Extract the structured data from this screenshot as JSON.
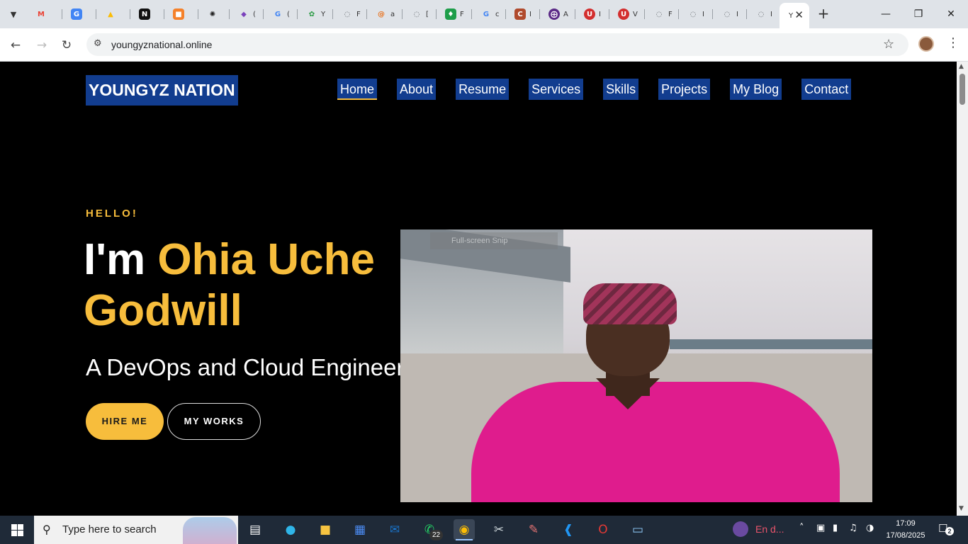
{
  "browser": {
    "tabs": [
      {
        "icon": "chevron-down-icon"
      },
      {
        "icon": "gmail-icon",
        "color": "#ea4335"
      },
      {
        "icon": "google-translate-icon",
        "color": "#4285f4"
      },
      {
        "icon": "google-drive-icon",
        "color": "#fbbc04"
      },
      {
        "icon": "notion-icon",
        "color": "#111111"
      },
      {
        "icon": "box-icon",
        "color": "#f5812a"
      },
      {
        "icon": "openai-icon",
        "color": "#222222"
      },
      {
        "icon": "terraform-icon",
        "color": "#7b42bc"
      },
      {
        "icon": "google-icon",
        "color": "#4285f4",
        "trunc": "("
      },
      {
        "icon": "leaf-icon",
        "color": "#2c9b45",
        "trunc": "Y"
      },
      {
        "icon": "globe-icon",
        "color": "#5f6368",
        "trunc": "F"
      },
      {
        "icon": "spiral-icon",
        "color": "#e8711c",
        "trunc": "a"
      },
      {
        "icon": "globe-icon",
        "color": "#5f6368",
        "trunc": "["
      },
      {
        "icon": "gem-icon",
        "color": "#1e9e4a",
        "trunc": "F"
      },
      {
        "icon": "google-icon",
        "color": "#4285f4",
        "trunc": "c"
      },
      {
        "icon": "letter-c-icon",
        "color": "#b04a2d",
        "trunc": "I"
      },
      {
        "icon": "target-icon",
        "color": "#5b2a86",
        "trunc": "A"
      },
      {
        "icon": "shield-icon",
        "color": "#d32f2f",
        "trunc": "I"
      },
      {
        "icon": "shield-icon",
        "color": "#d32f2f",
        "trunc": "V"
      },
      {
        "icon": "globe-icon",
        "color": "#5f6368",
        "trunc": "F"
      },
      {
        "icon": "globe-icon",
        "color": "#5f6368",
        "trunc": "I"
      },
      {
        "icon": "globe-icon",
        "color": "#5f6368",
        "trunc": "I"
      },
      {
        "icon": "globe-icon",
        "color": "#5f6368",
        "trunc": "I"
      }
    ],
    "active_tab_trunc": "Y",
    "url": "youngyznational.online"
  },
  "site": {
    "logo": "YOUNGYZ NATION",
    "nav": [
      "Home",
      "About",
      "Resume",
      "Services",
      "Skills",
      "Projects",
      "My Blog",
      "Contact"
    ],
    "active_nav": "Home",
    "hello": "HELLO!",
    "headline_prefix": "I'm ",
    "headline_name_1": "Ohia Uche",
    "headline_name_2": "Godwill",
    "role": "A DevOps and Cloud Engineer",
    "hire_label": "HIRE ME",
    "works_label": "MY WORKS",
    "photo_caption": "Full-screen Snip",
    "accent_color": "#f7bd3c",
    "highlight_color": "#123d8f"
  },
  "taskbar": {
    "search_placeholder": "Type here to search",
    "whatsapp_badge": "22",
    "language": "En d...",
    "time": "17:09",
    "date": "17/08/2025",
    "notifications": "2",
    "apps": [
      "task-view-icon",
      "edge-icon",
      "file-explorer-icon",
      "store-icon",
      "outlook-icon",
      "whatsapp-icon",
      "chrome-icon",
      "snipping-tool-icon",
      "paint-icon",
      "vscode-icon",
      "opera-icon",
      "notepad-icon"
    ]
  }
}
